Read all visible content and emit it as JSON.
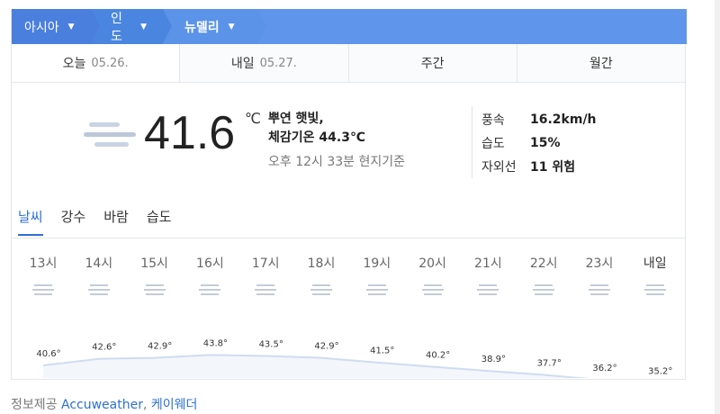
{
  "breadcrumb": [
    {
      "label": "아시아"
    },
    {
      "label": "인도"
    },
    {
      "label": "뉴델리"
    }
  ],
  "day_tabs": [
    {
      "label": "오늘",
      "date": "05.26."
    },
    {
      "label": "내일",
      "date": "05.27."
    },
    {
      "label": "주간",
      "date": ""
    },
    {
      "label": "월간",
      "date": ""
    }
  ],
  "current": {
    "icon": "cloudy-haze-icon",
    "temperature": "41.6",
    "unit": "℃",
    "condition": "뿌연 햇빛,",
    "feels_like_label": "체감기온",
    "feels_like": "44.3℃",
    "observed": "오후 12시 33분 현지기준"
  },
  "stats": [
    {
      "label": "풍속",
      "value": "16.2km/h"
    },
    {
      "label": "습도",
      "value": "15%"
    },
    {
      "label": "자외선",
      "value": "11 위험"
    }
  ],
  "sub_tabs": [
    "날씨",
    "강수",
    "바람",
    "습도"
  ],
  "hourly": {
    "hours": [
      "13시",
      "14시",
      "15시",
      "16시",
      "17시",
      "18시",
      "19시",
      "20시",
      "21시",
      "22시",
      "23시",
      "내일"
    ],
    "temps": [
      40.6,
      42.6,
      42.9,
      43.8,
      43.5,
      42.9,
      41.5,
      40.2,
      38.9,
      37.7,
      36.2,
      35.2
    ],
    "labels": [
      "40.6°",
      "42.6°",
      "42.9°",
      "43.8°",
      "43.5°",
      "42.9°",
      "41.5°",
      "40.2°",
      "38.9°",
      "37.7°",
      "36.2°",
      "35.2°"
    ],
    "max_color": "#e05a4f",
    "next_day_color": "#3a87e0"
  },
  "footer": {
    "prefix": "정보제공",
    "source1": "Accuweather",
    "separator": ",",
    "source2": "케이웨더"
  },
  "colors": {
    "breadcrumb_bg": "#5a8fe6",
    "accent": "#2d6fd6"
  }
}
